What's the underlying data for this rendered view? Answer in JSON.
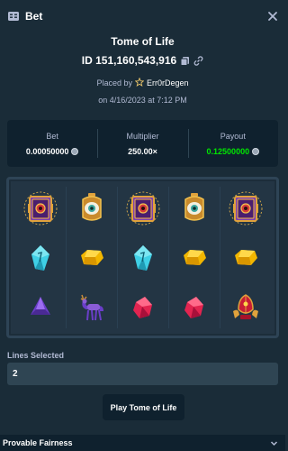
{
  "header": {
    "title": "Bet"
  },
  "bet": {
    "game_name": "Tome of Life",
    "id_label": "ID 151,160,543,916",
    "placed_by_prefix": "Placed by",
    "username": "Err0rDegen",
    "date": "on 4/16/2023 at 7:12 PM"
  },
  "stats": {
    "bet_label": "Bet",
    "bet_value": "0.00050000",
    "multiplier_label": "Multiplier",
    "multiplier_value": "250.00×",
    "payout_label": "Payout",
    "payout_value": "0.12500000"
  },
  "board": {
    "reels": [
      [
        "book-symbol",
        "blue-gem-symbol",
        "purple-gem-symbol"
      ],
      [
        "lantern-eye-symbol",
        "gold-gem-symbol",
        "deer-symbol"
      ],
      [
        "book-symbol",
        "blue-gem-symbol",
        "red-gem-symbol"
      ],
      [
        "lantern-eye-symbol",
        "gold-gem-symbol",
        "red-gem-symbol"
      ],
      [
        "book-symbol",
        "gold-gem-symbol",
        "scarab-symbol"
      ]
    ]
  },
  "lines": {
    "label": "Lines Selected",
    "value": "2"
  },
  "play_button": {
    "label": "Play Tome of Life"
  },
  "footer": {
    "label": "Provable Fairness"
  },
  "colors": {
    "background": "#1a2c38",
    "panel": "#0f212e",
    "input": "#2f4553",
    "muted_text": "#b1bad3",
    "payout_green": "#00e701"
  }
}
